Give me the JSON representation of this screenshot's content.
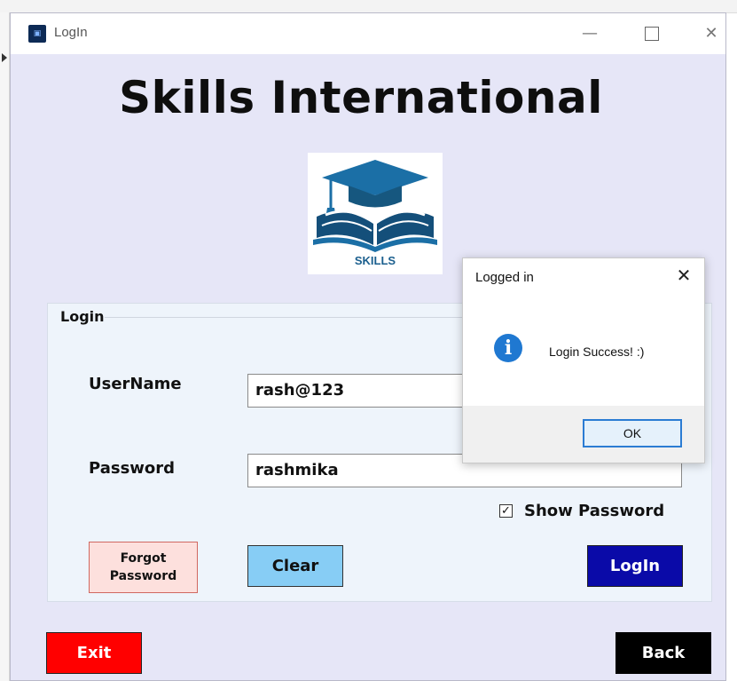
{
  "window": {
    "title": "LogIn",
    "app_icon": "app-icon",
    "minimize_glyph": "—",
    "close_glyph": "✕"
  },
  "app": {
    "heading": "Skills International",
    "logo_text": "SKILLS"
  },
  "login_group": {
    "label": "Login",
    "username_label": "UserName",
    "username_value": "rash@123",
    "password_label": "Password",
    "password_value": "rashmika",
    "show_password_label": "Show Password",
    "show_password_checked": true,
    "check_glyph": "✓"
  },
  "buttons": {
    "forgot_line1": "Forgot",
    "forgot_line2": "Password",
    "clear": "Clear",
    "login": "LogIn",
    "exit": "Exit",
    "back": "Back"
  },
  "dialog": {
    "title": "Logged in",
    "close_glyph": "✕",
    "icon": "info-icon",
    "icon_glyph": "i",
    "message": "Login Success! :)",
    "ok_label": "OK"
  },
  "colors": {
    "window_bg": "#e6e6f7",
    "group_bg": "#eef4fb",
    "forgot_bg": "#fde0dd",
    "clear_bg": "#87cdf5",
    "login_bg": "#0a0aa8",
    "exit_bg": "#ff0000",
    "back_bg": "#000000",
    "info_icon": "#1f78d1"
  }
}
